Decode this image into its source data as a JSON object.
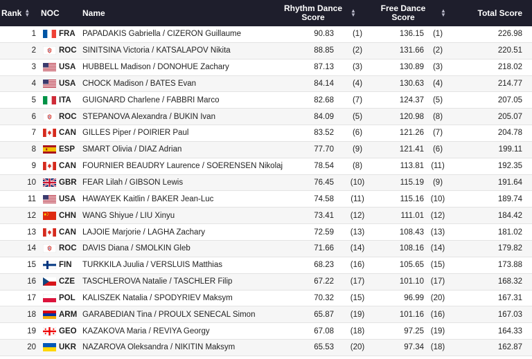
{
  "headers": {
    "rank": "Rank",
    "noc": "NOC",
    "name": "Name",
    "rhythm_line1": "Rhythm Dance",
    "rhythm_line2": "Score",
    "free_line1": "Free Dance",
    "free_line2": "Score",
    "total": "Total Score"
  },
  "rows": [
    {
      "rank": "1",
      "noc": "FRA",
      "flag": "fra-flag-icon",
      "name": "PAPADAKIS Gabriella / CIZERON Guillaume",
      "rd": "90.83",
      "rd_rank": "(1)",
      "fd": "136.15",
      "fd_rank": "(1)",
      "total": "226.98"
    },
    {
      "rank": "2",
      "noc": "ROC",
      "flag": "roc-emblem-icon",
      "name": "SINITSINA Victoria / KATSALAPOV Nikita",
      "rd": "88.85",
      "rd_rank": "(2)",
      "fd": "131.66",
      "fd_rank": "(2)",
      "total": "220.51"
    },
    {
      "rank": "3",
      "noc": "USA",
      "flag": "usa-flag-icon",
      "name": "HUBBELL Madison / DONOHUE Zachary",
      "rd": "87.13",
      "rd_rank": "(3)",
      "fd": "130.89",
      "fd_rank": "(3)",
      "total": "218.02"
    },
    {
      "rank": "4",
      "noc": "USA",
      "flag": "usa-flag-icon",
      "name": "CHOCK Madison / BATES Evan",
      "rd": "84.14",
      "rd_rank": "(4)",
      "fd": "130.63",
      "fd_rank": "(4)",
      "total": "214.77"
    },
    {
      "rank": "5",
      "noc": "ITA",
      "flag": "ita-flag-icon",
      "name": "GUIGNARD Charlene / FABBRI Marco",
      "rd": "82.68",
      "rd_rank": "(7)",
      "fd": "124.37",
      "fd_rank": "(5)",
      "total": "207.05"
    },
    {
      "rank": "6",
      "noc": "ROC",
      "flag": "roc-emblem-icon",
      "name": "STEPANOVA Alexandra / BUKIN Ivan",
      "rd": "84.09",
      "rd_rank": "(5)",
      "fd": "120.98",
      "fd_rank": "(8)",
      "total": "205.07"
    },
    {
      "rank": "7",
      "noc": "CAN",
      "flag": "can-flag-icon",
      "name": "GILLES Piper / POIRIER Paul",
      "rd": "83.52",
      "rd_rank": "(6)",
      "fd": "121.26",
      "fd_rank": "(7)",
      "total": "204.78"
    },
    {
      "rank": "8",
      "noc": "ESP",
      "flag": "esp-flag-icon",
      "name": "SMART Olivia / DIAZ Adrian",
      "rd": "77.70",
      "rd_rank": "(9)",
      "fd": "121.41",
      "fd_rank": "(6)",
      "total": "199.11"
    },
    {
      "rank": "9",
      "noc": "CAN",
      "flag": "can-flag-icon",
      "name": "FOURNIER BEAUDRY Laurence / SOERENSEN Nikolaj",
      "rd": "78.54",
      "rd_rank": "(8)",
      "fd": "113.81",
      "fd_rank": "(11)",
      "total": "192.35"
    },
    {
      "rank": "10",
      "noc": "GBR",
      "flag": "gbr-flag-icon",
      "name": "FEAR Lilah / GIBSON Lewis",
      "rd": "76.45",
      "rd_rank": "(10)",
      "fd": "115.19",
      "fd_rank": "(9)",
      "total": "191.64"
    },
    {
      "rank": "11",
      "noc": "USA",
      "flag": "usa-flag-icon",
      "name": "HAWAYEK Kaitlin / BAKER Jean-Luc",
      "rd": "74.58",
      "rd_rank": "(11)",
      "fd": "115.16",
      "fd_rank": "(10)",
      "total": "189.74"
    },
    {
      "rank": "12",
      "noc": "CHN",
      "flag": "chn-flag-icon",
      "name": "WANG Shiyue / LIU Xinyu",
      "rd": "73.41",
      "rd_rank": "(12)",
      "fd": "111.01",
      "fd_rank": "(12)",
      "total": "184.42"
    },
    {
      "rank": "13",
      "noc": "CAN",
      "flag": "can-flag-icon",
      "name": "LAJOIE Marjorie / LAGHA Zachary",
      "rd": "72.59",
      "rd_rank": "(13)",
      "fd": "108.43",
      "fd_rank": "(13)",
      "total": "181.02"
    },
    {
      "rank": "14",
      "noc": "ROC",
      "flag": "roc-emblem-icon",
      "name": "DAVIS Diana / SMOLKIN Gleb",
      "rd": "71.66",
      "rd_rank": "(14)",
      "fd": "108.16",
      "fd_rank": "(14)",
      "total": "179.82"
    },
    {
      "rank": "15",
      "noc": "FIN",
      "flag": "fin-flag-icon",
      "name": "TURKKILA Juulia / VERSLUIS Matthias",
      "rd": "68.23",
      "rd_rank": "(16)",
      "fd": "105.65",
      "fd_rank": "(15)",
      "total": "173.88"
    },
    {
      "rank": "16",
      "noc": "CZE",
      "flag": "cze-flag-icon",
      "name": "TASCHLEROVA Natalie / TASCHLER Filip",
      "rd": "67.22",
      "rd_rank": "(17)",
      "fd": "101.10",
      "fd_rank": "(17)",
      "total": "168.32"
    },
    {
      "rank": "17",
      "noc": "POL",
      "flag": "pol-flag-icon",
      "name": "KALISZEK Natalia / SPODYRIEV Maksym",
      "rd": "70.32",
      "rd_rank": "(15)",
      "fd": "96.99",
      "fd_rank": "(20)",
      "total": "167.31"
    },
    {
      "rank": "18",
      "noc": "ARM",
      "flag": "arm-flag-icon",
      "name": "GARABEDIAN Tina / PROULX SENECAL Simon",
      "rd": "65.87",
      "rd_rank": "(19)",
      "fd": "101.16",
      "fd_rank": "(16)",
      "total": "167.03"
    },
    {
      "rank": "19",
      "noc": "GEO",
      "flag": "geo-flag-icon",
      "name": "KAZAKOVA Maria / REVIYA Georgy",
      "rd": "67.08",
      "rd_rank": "(18)",
      "fd": "97.25",
      "fd_rank": "(19)",
      "total": "164.33"
    },
    {
      "rank": "20",
      "noc": "UKR",
      "flag": "ukr-flag-icon",
      "name": "NAZAROVA Oleksandra / NIKITIN Maksym",
      "rd": "65.53",
      "rd_rank": "(20)",
      "fd": "97.34",
      "fd_rank": "(18)",
      "total": "162.87"
    }
  ]
}
